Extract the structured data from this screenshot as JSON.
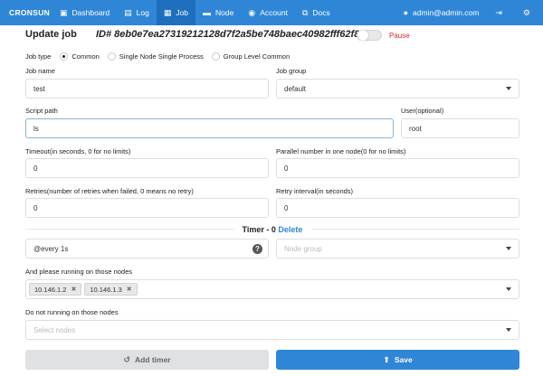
{
  "nav": {
    "brand": "CRONSUN",
    "items": [
      {
        "label": "Dashboard",
        "icon": "dashboard-icon",
        "glyph": "▣"
      },
      {
        "label": "Log",
        "icon": "file-icon",
        "glyph": "▤"
      },
      {
        "label": "Job",
        "icon": "calendar-icon",
        "glyph": "▦"
      },
      {
        "label": "Node",
        "icon": "server-icon",
        "glyph": "▬"
      },
      {
        "label": "Account",
        "icon": "users-icon",
        "glyph": "◉"
      },
      {
        "label": "Docs",
        "icon": "external-link-icon",
        "glyph": "⧉"
      }
    ],
    "active": "Job",
    "user": "admin@admin.com",
    "user_icon": "user-icon",
    "logout_icon": "sign-out-icon",
    "settings_icon": "gear-icon"
  },
  "form": {
    "title": "Update job",
    "job_id": "ID# 8eb0e7ea27319212128d7f2a5be748baec40982fff62f844",
    "pause_label": "Pause",
    "pause_on": false,
    "job_type_label": "Job type",
    "job_types": [
      "Common",
      "Single Node Single Process",
      "Group Level Common"
    ],
    "job_type_selected": 0,
    "job_name_label": "Job name",
    "job_name": "test",
    "job_group_label": "Job group",
    "job_group": "default",
    "script_path_label": "Script path",
    "script_path": "ls",
    "user_label": "User(optional)",
    "user": "root",
    "timeout_label": "Timeout(in seconds, 0 for no limits)",
    "timeout": "0",
    "parallel_label": "Parallel number in one node(0 for no limits)",
    "parallel": "0",
    "retries_label": "Retries(number of retries when failed, 0 means no retry)",
    "retries": "0",
    "retry_interval_label": "Retry interval(in seconds)",
    "retry_interval": "0",
    "timer_heading": "Timer - 0",
    "timer_delete": "Delete",
    "timer_value": "@every 1s",
    "node_group_placeholder": "Node group",
    "nodes_label": "And please running on those nodes",
    "nodes": [
      "10.146.1.2",
      "10.146.1.3"
    ],
    "exclude_label": "Do not running on those nodes",
    "exclude_placeholder": "Select nodes",
    "add_timer_label": "Add timer",
    "save_label": "Save"
  }
}
